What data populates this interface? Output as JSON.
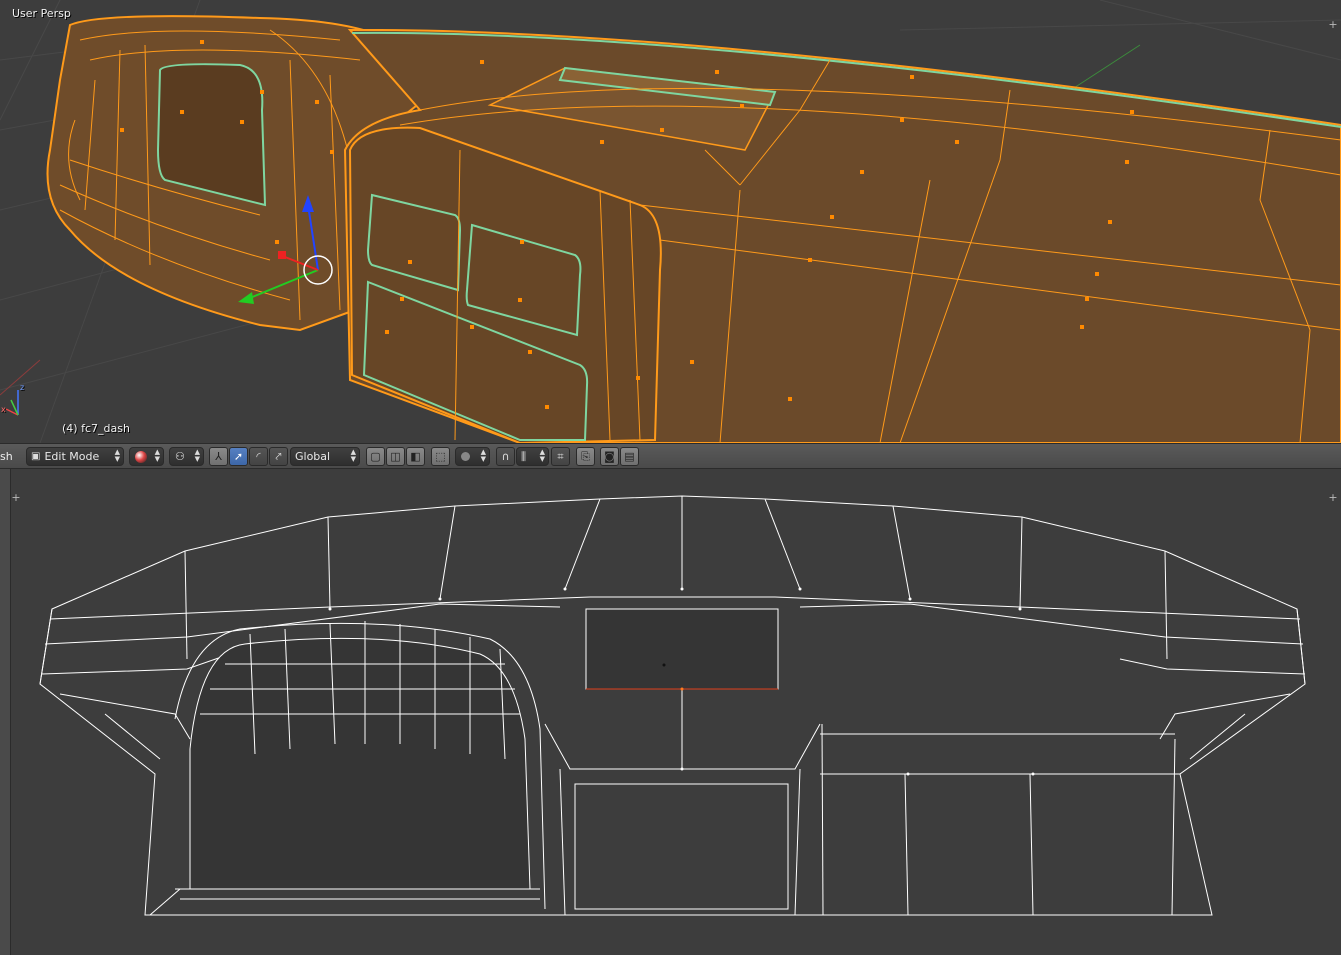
{
  "top_viewport": {
    "view_label": "User Persp",
    "object_label": "(4) fc7_dash",
    "axis_labels": {
      "z": "z",
      "x": "x"
    }
  },
  "header": {
    "editor_partial": "sh",
    "mode": {
      "label": "Edit Mode",
      "icon": "edit-mode-icon"
    },
    "shading": {
      "icon": "sphere-shading-icon"
    },
    "pivot": {
      "icon": "pivot-point-icon"
    },
    "manipulators": [
      {
        "icon": "manipulator-toggle-icon",
        "active": false
      },
      {
        "icon": "translate-arrow-icon",
        "active": true
      },
      {
        "icon": "rotate-arc-icon",
        "active": false
      },
      {
        "icon": "scale-icon",
        "active": false
      }
    ],
    "orientation": "Global",
    "select_modes": [
      {
        "icon": "vertex-select-icon",
        "active": false
      },
      {
        "icon": "edge-select-icon",
        "active": false
      },
      {
        "icon": "face-select-icon",
        "active": false
      }
    ],
    "colors": {
      "active": "#5680c2",
      "button": "#7b7b7b"
    }
  },
  "theme": {
    "mesh_fill": "#6b4a2a",
    "mesh_edge": "#ff9a1a",
    "seam": "#7fd6a0",
    "wire": "#ffffff",
    "grid": "#4a4a4a"
  }
}
